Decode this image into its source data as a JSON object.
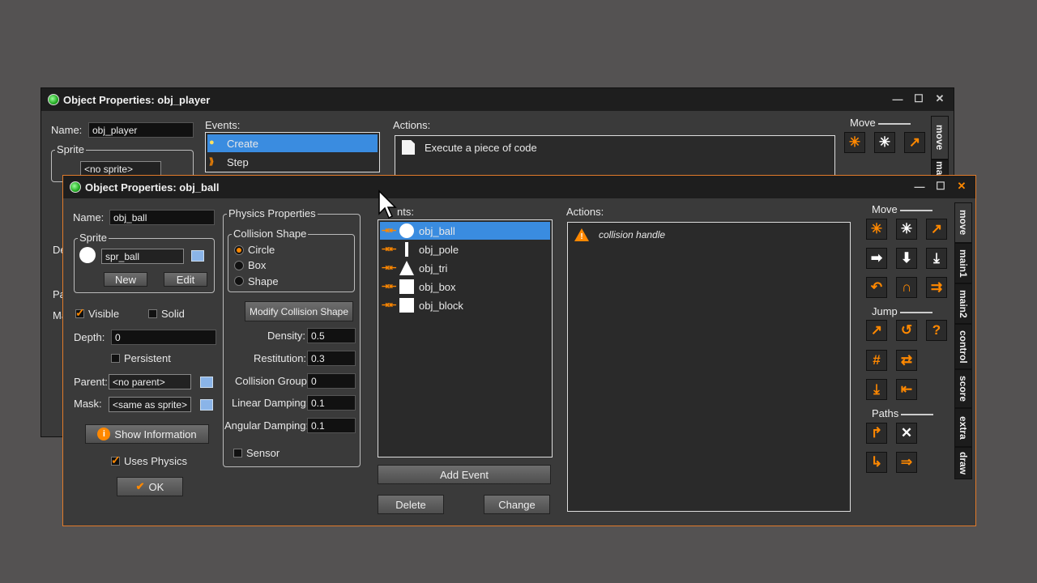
{
  "back_window": {
    "title": "Object Properties: obj_player",
    "name_label": "Name:",
    "name_value": "obj_player",
    "sprite_group": "Sprite",
    "sprite_value": "<no sprite>",
    "events_label": "Events:",
    "events": [
      {
        "label": "Create",
        "selected": true
      },
      {
        "label": "Step",
        "selected": false
      }
    ],
    "actions_label": "Actions:",
    "actions": [
      "Execute a piece of code"
    ],
    "move_label": "Move",
    "tabs": [
      "move",
      "mai"
    ],
    "partial_labels": [
      "De",
      "Pa",
      "Ma"
    ]
  },
  "front_window": {
    "title": "Object Properties: obj_ball",
    "name_label": "Name:",
    "name_value": "obj_ball",
    "sprite_group": "Sprite",
    "sprite_value": "spr_ball",
    "new_button": "New",
    "edit_button": "Edit",
    "visible_label": "Visible",
    "solid_label": "Solid",
    "depth_label": "Depth:",
    "depth_value": "0",
    "persistent_label": "Persistent",
    "parent_label": "Parent:",
    "parent_value": "<no parent>",
    "mask_label": "Mask:",
    "mask_value": "<same as sprite>",
    "show_info_button": "Show Information",
    "uses_physics_label": "Uses Physics",
    "ok_button": "OK",
    "physics": {
      "group": "Physics Properties",
      "collision_shape_group": "Collision Shape",
      "shape_options": [
        "Circle",
        "Box",
        "Shape"
      ],
      "modify_button": "Modify Collision Shape",
      "density_label": "Density:",
      "density_value": "0.5",
      "restitution_label": "Restitution:",
      "restitution_value": "0.3",
      "group_label": "Collision Group:",
      "group_value": "0",
      "linear_label": "Linear Damping:",
      "linear_value": "0.1",
      "angular_label": "Angular Damping:",
      "angular_value": "0.1",
      "sensor_label": "Sensor"
    },
    "events_label": "nts:",
    "events": [
      {
        "label": "obj_ball",
        "shape": "circle",
        "selected": true
      },
      {
        "label": "obj_pole",
        "shape": "pole",
        "selected": false
      },
      {
        "label": "obj_tri",
        "shape": "triangle",
        "selected": false
      },
      {
        "label": "obj_box",
        "shape": "square",
        "selected": false
      },
      {
        "label": "obj_block",
        "shape": "square",
        "selected": false
      }
    ],
    "add_event_button": "Add Event",
    "delete_button": "Delete",
    "change_button": "Change",
    "actions_label": "Actions:",
    "actions": [
      "collision handle"
    ],
    "toolbox": {
      "move_label": "Move",
      "jump_label": "Jump",
      "paths_label": "Paths"
    },
    "tabs": [
      "move",
      "main1",
      "main2",
      "control",
      "score",
      "extra",
      "draw"
    ]
  },
  "colors": {
    "accent": "#ff8800",
    "selection": "#3a8ce0",
    "background": "#545252"
  }
}
